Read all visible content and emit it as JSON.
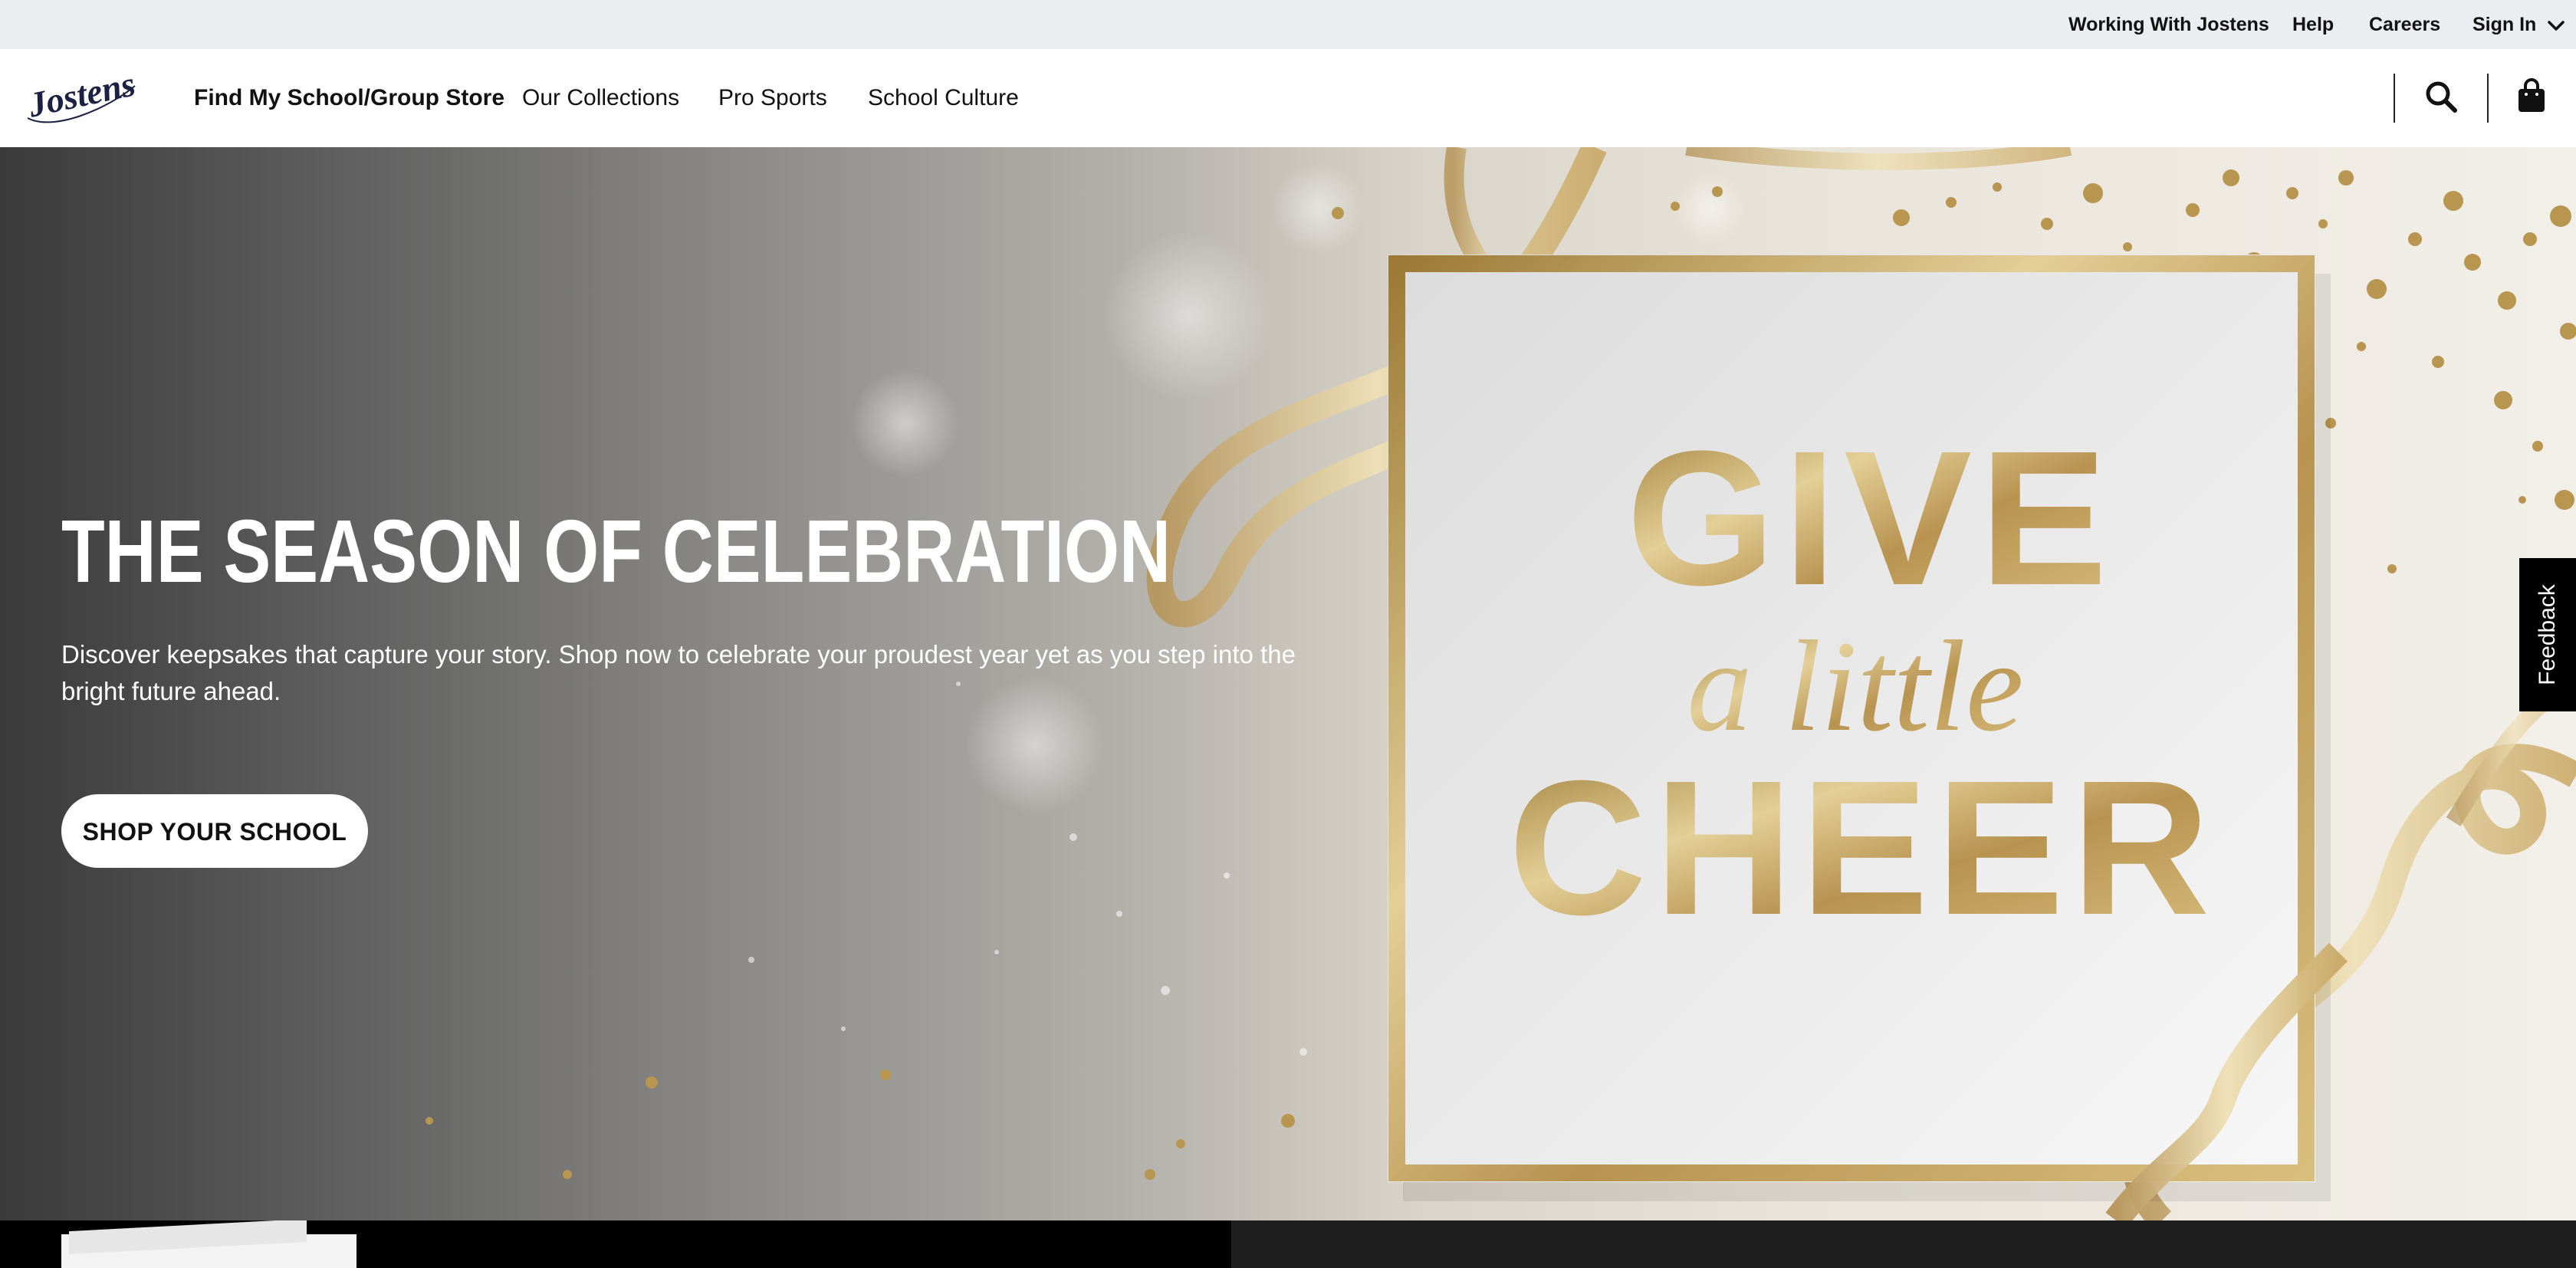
{
  "utility_nav": {
    "working_with": "Working With Jostens",
    "help": "Help",
    "careers": "Careers",
    "sign_in": "Sign In"
  },
  "brand": {
    "logo_text": "Jostens"
  },
  "main_nav": {
    "items": [
      {
        "label": "Find My School/Group Store"
      },
      {
        "label": "Our Collections"
      },
      {
        "label": "Pro Sports"
      },
      {
        "label": "School Culture"
      }
    ]
  },
  "header_icons": {
    "search": "search-icon",
    "cart": "shopping-bag-icon"
  },
  "hero": {
    "title": "THE SEASON OF CELEBRATION",
    "description": "Discover keepsakes that capture your story. Shop now to celebrate your proudest year yet as you step into the bright future ahead.",
    "cta_label": "SHOP YOUR SCHOOL",
    "art": {
      "line1": "GIVE",
      "line2": "a little",
      "line3": "CHEER"
    }
  },
  "feedback": {
    "label": "Feedback"
  },
  "colors": {
    "utility_bg": "#ecedf0",
    "gold": "#c7a760",
    "text_dark": "#111111",
    "feedback_bg": "#000000"
  }
}
